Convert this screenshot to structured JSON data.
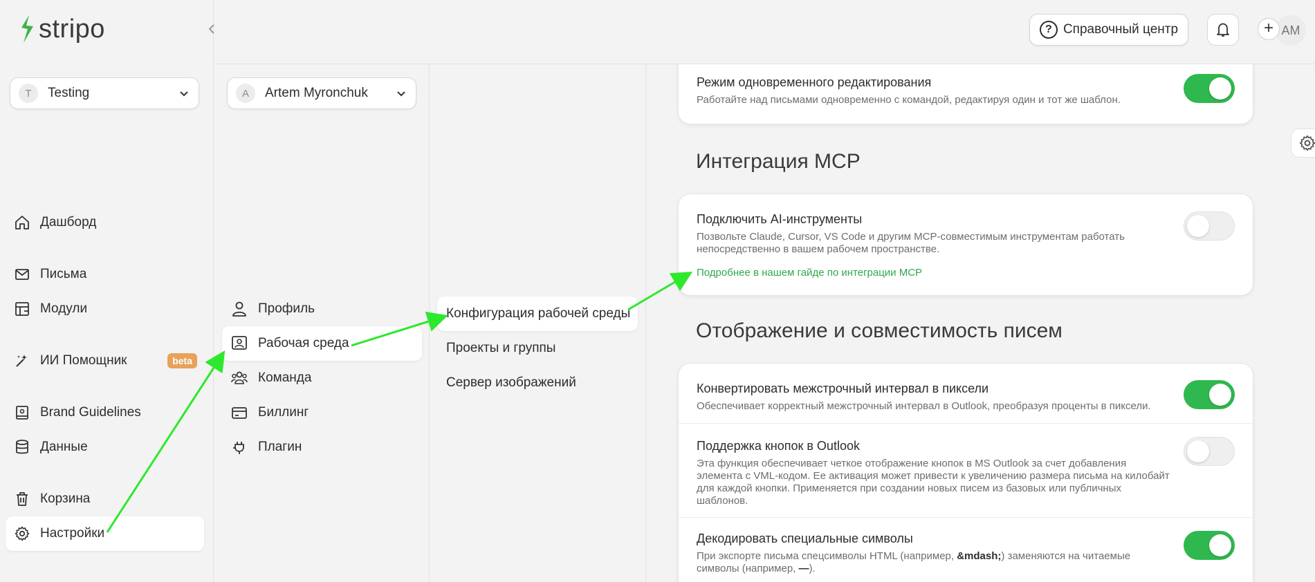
{
  "app": {
    "logo_text": "stripo"
  },
  "sidebar": {
    "workspace_select": {
      "letter": "T",
      "label": "Testing"
    },
    "items": [
      {
        "label": "Дашборд",
        "icon": "home-icon"
      },
      {
        "label": "Письма",
        "icon": "mail-icon"
      },
      {
        "label": "Модули",
        "icon": "modules-icon"
      },
      {
        "label": "ИИ Помощник",
        "icon": "magic-wand-icon",
        "badge": "beta"
      },
      {
        "label": "Brand Guidelines",
        "icon": "brand-book-icon"
      },
      {
        "label": "Данные",
        "icon": "database-icon"
      },
      {
        "label": "Корзина",
        "icon": "trash-icon"
      },
      {
        "label": "Настройки",
        "icon": "gear-icon",
        "active": true
      }
    ]
  },
  "settings_nav": {
    "user_select": {
      "letter": "A",
      "label": "Artem Myronchuk"
    },
    "items": [
      {
        "label": "Профиль",
        "icon": "user-icon"
      },
      {
        "label": "Рабочая среда",
        "icon": "workspace-icon",
        "active": true
      },
      {
        "label": "Команда",
        "icon": "team-icon"
      },
      {
        "label": "Биллинг",
        "icon": "card-icon"
      },
      {
        "label": "Плагин",
        "icon": "plug-icon"
      }
    ]
  },
  "workspace_nav": {
    "items": [
      {
        "label": "Конфигурация рабочей среды",
        "active": true
      },
      {
        "label": "Проекты и группы"
      },
      {
        "label": "Сервер изображений"
      }
    ]
  },
  "topbar": {
    "help_label": "Справочный центр",
    "avatar_initials": "AM"
  },
  "content": {
    "collab_row": {
      "title": "Режим одновременного редактирования",
      "desc": "Работайте над письмами одновременно с командой, редактируя один и тот же шаблон.",
      "enabled": true
    },
    "mcp": {
      "section_title": "Интеграция MCP",
      "row": {
        "title": "Подключить AI-инструменты",
        "desc": "Позвольте Claude, Cursor, VS Code и другим MCP-совместимым инструментам работать непосредственно в вашем рабочем пространстве.",
        "link": "Подробнее в нашем гайде по интеграции MCP",
        "enabled": false
      }
    },
    "display": {
      "section_title": "Отображение и совместимость писем",
      "rows": [
        {
          "title": "Конвертировать межстрочный интервал в пиксели",
          "desc": "Обеспечивает корректный межстрочный интервал в Outlook, преобразуя проценты в пиксели.",
          "enabled": true
        },
        {
          "title": "Поддержка кнопок в Outlook",
          "desc": "Эта функция обеспечивает четкое отображение кнопок в MS Outlook за счет добавления элемента с VML-кодом. Ее активация может привести к увеличению размера письма на килобайт для каждой кнопки. Применяется при создании новых писем из базовых или публичных шаблонов.",
          "enabled": false
        },
        {
          "title": "Декодировать специальные символы",
          "desc_before": "При экспорте письма спецсимволы HTML (например, ",
          "desc_bold1": "&mdash;",
          "desc_middle": ") заменяются на читаемые символы (например, ",
          "desc_bold2": "—",
          "desc_after": ").",
          "enabled": true
        }
      ]
    }
  },
  "colors": {
    "accent_green": "#2fb84f",
    "link_green": "#2ea84c",
    "annotation_arrow": "#2ee82e",
    "beta_badge": "#e8a25a"
  }
}
